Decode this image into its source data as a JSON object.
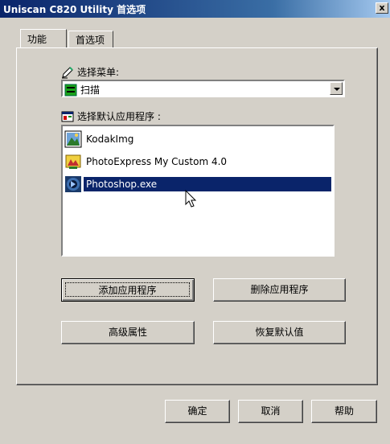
{
  "window": {
    "title": "Uniscan C820 Utility 首选项",
    "close_label": "x"
  },
  "tabs": [
    {
      "label": "功能",
      "active": true
    },
    {
      "label": "首选项",
      "active": false
    }
  ],
  "menu_section": {
    "label": "选择菜单:",
    "selected_value": "扫描"
  },
  "app_section": {
    "label": "选择默认应用程序 :",
    "apps": [
      {
        "label": "KodakImg",
        "icon": "kodak-img-icon",
        "selected": false
      },
      {
        "label": "PhotoExpress My Custom 4.0",
        "icon": "photoexpress-icon",
        "selected": false
      },
      {
        "label": "Photoshop.exe",
        "icon": "photoshop-icon",
        "selected": true
      }
    ]
  },
  "buttons": {
    "add_app": "添加应用程序",
    "remove_app": "删除应用程序",
    "advanced": "高级属性",
    "restore_default": "恢复默认值",
    "ok": "确定",
    "cancel": "取消",
    "help": "帮助"
  },
  "colors": {
    "title_bar": "#0a246a",
    "selection": "#0a246a",
    "dialog_bg": "#d4d0c8"
  }
}
